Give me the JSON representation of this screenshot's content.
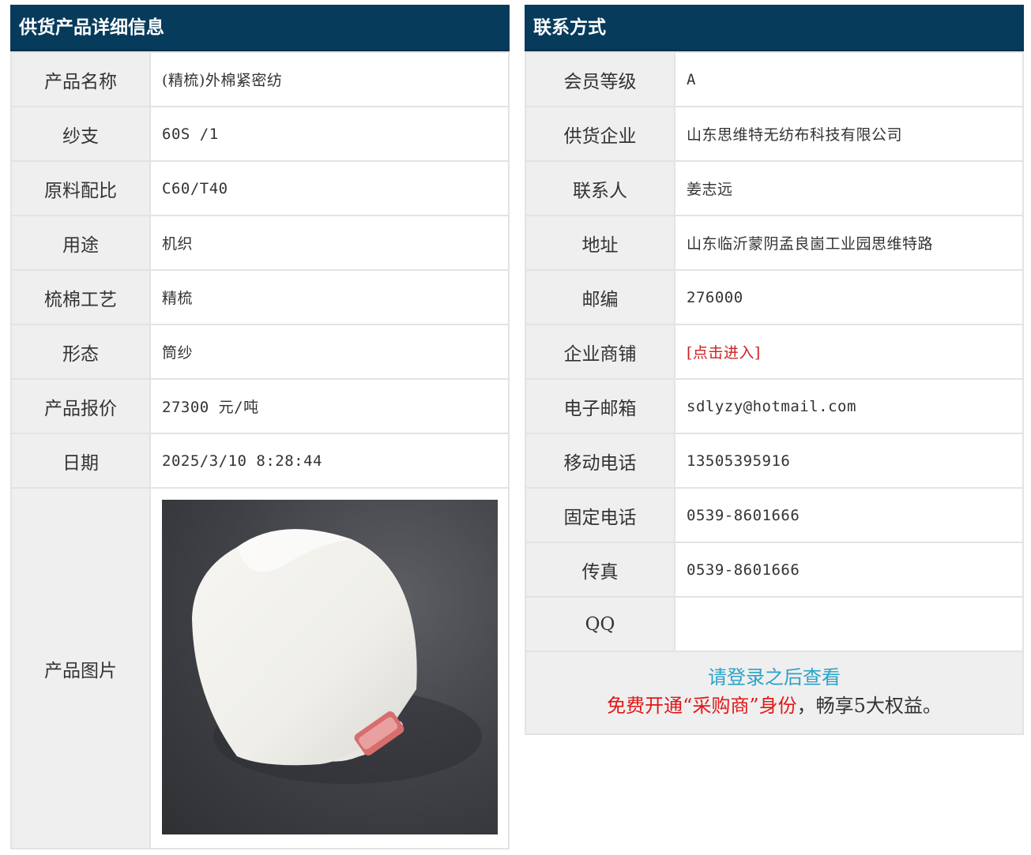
{
  "left": {
    "title": "供货产品详细信息",
    "rows": [
      {
        "label": "产品名称",
        "value": "(精梳)外棉紧密纺"
      },
      {
        "label": "纱支",
        "value": "60S /1"
      },
      {
        "label": "原料配比",
        "value": "C60/T40"
      },
      {
        "label": "用途",
        "value": "机织"
      },
      {
        "label": "梳棉工艺",
        "value": "精梳"
      },
      {
        "label": "形态",
        "value": "筒纱"
      },
      {
        "label": "产品报价",
        "value": "27300 元/吨"
      },
      {
        "label": "日期",
        "value": "2025/3/10 8:28:44"
      }
    ],
    "image_label": "产品图片"
  },
  "right": {
    "title": "联系方式",
    "rows": [
      {
        "label": "会员等级",
        "value": "A"
      },
      {
        "label": "供货企业",
        "value": "山东思维特无纺布科技有限公司"
      },
      {
        "label": "联系人",
        "value": "姜志远"
      },
      {
        "label": "地址",
        "value": "山东临沂蒙阴孟良崮工业园思维特路"
      },
      {
        "label": "邮编",
        "value": "276000"
      },
      {
        "label": "企业商铺",
        "value": "[点击进入]"
      },
      {
        "label": "电子邮箱",
        "value": "sdlyzy@hotmail.com"
      },
      {
        "label": "移动电话",
        "value": "13505395916"
      },
      {
        "label": "固定电话",
        "value": "0539-8601666"
      },
      {
        "label": "传真",
        "value": "0539-8601666"
      },
      {
        "label": "QQ",
        "value": ""
      }
    ],
    "login_text": "请登录之后查看",
    "benefit_red": "免费开通“采购商”身份",
    "benefit_dark": "，畅享5大权益。"
  },
  "colors": {
    "header_bg": "#073b5c",
    "label_bg": "#efefef",
    "link_red": "#cc2222",
    "login_blue": "#2aa3c9",
    "benefit_red": "#e01818"
  }
}
